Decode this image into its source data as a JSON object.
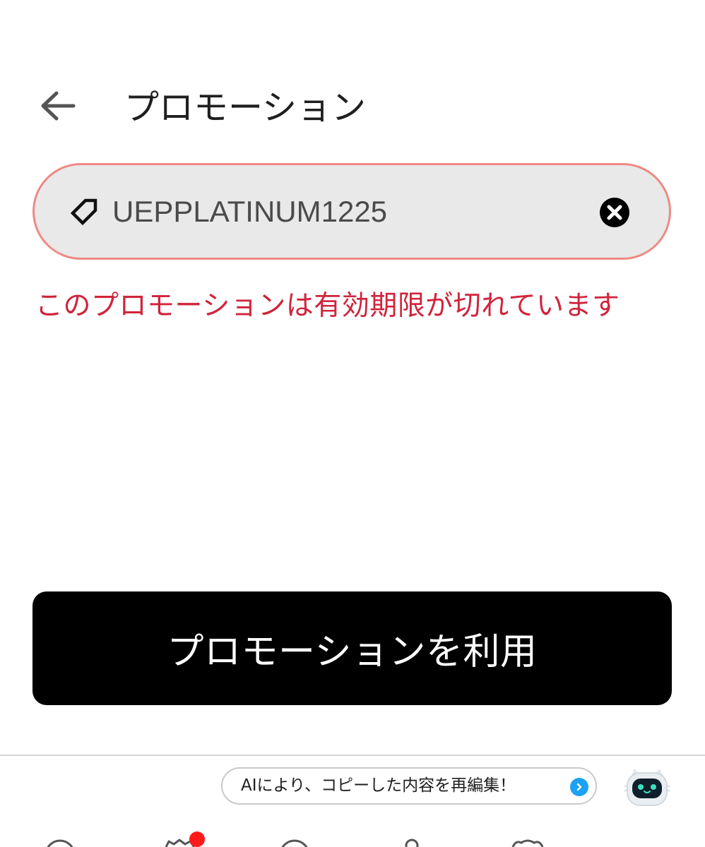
{
  "header": {
    "title": "プロモーション",
    "back_icon": "arrow-left-icon"
  },
  "promo": {
    "code_value": "UEPPLATINUM1225",
    "tag_icon": "tag-icon",
    "clear_icon": "close-circle-icon",
    "border_color": "#ef8a84",
    "error_message": "このプロモーションは有効期限が切れています",
    "error_color": "#d0243c"
  },
  "apply_button": {
    "label": "プロモーションを利用"
  },
  "keyboard": {
    "ai_suggestion": "AIにより、コピーした内容を再編集！",
    "arrow_icon": "chevron-right-icon",
    "assistant_icon": "robot-cat-icon",
    "toolbar_icons": [
      "emoji-icon",
      "sticker-icon",
      "search-icon",
      "mic-icon",
      "cat-icon"
    ]
  }
}
